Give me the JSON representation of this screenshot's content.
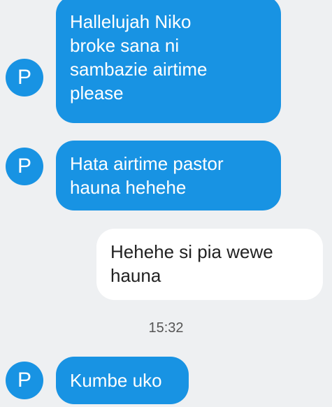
{
  "messages": [
    {
      "sender": "P",
      "direction": "incoming",
      "text": "Hallelujah Niko\nbroke sana ni\nsambazie airtime\nplease"
    },
    {
      "sender": "P",
      "direction": "incoming",
      "text": "Hata airtime pastor\nhauna hehehe"
    },
    {
      "direction": "outgoing",
      "text": "Hehehe si pia wewe\nhauna"
    },
    {
      "sender": "P",
      "direction": "incoming",
      "text": "Kumbe uko"
    }
  ],
  "timestamp": "15:32",
  "colors": {
    "incoming_bubble": "#1893e3",
    "outgoing_bubble": "#ffffff",
    "avatar": "#1893e3",
    "background": "#eef0f2"
  }
}
